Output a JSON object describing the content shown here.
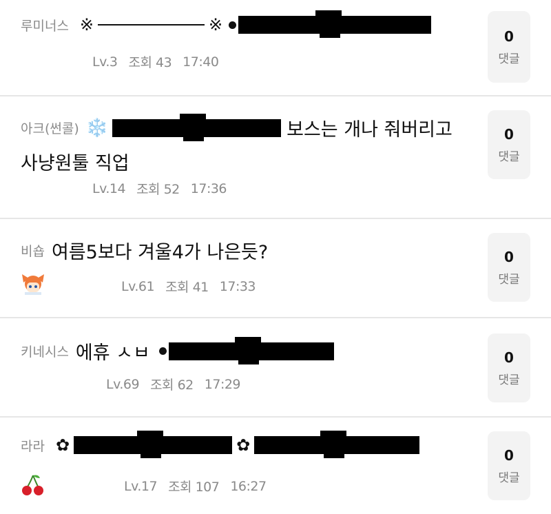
{
  "posts": [
    {
      "category": "루미너스",
      "title_prefix_1": "※",
      "title_prefix_2": "※",
      "title_text": "",
      "title_line2": "",
      "level": "Lv.3",
      "views": "조회 43",
      "time": "17:40",
      "comments": "0",
      "comments_label": "댓글"
    },
    {
      "category": "아크(썬콜)",
      "emoji": "❄️",
      "title_text": "보스는 개나 줘버리고",
      "title_line2": "사냥원툴 직업",
      "level": "Lv.14",
      "views": "조회 52",
      "time": "17:36",
      "comments": "0",
      "comments_label": "댓글"
    },
    {
      "category": "비숍",
      "title_text": "여름5보다 겨울4가 나은듯?",
      "title_line2": "",
      "level": "Lv.61",
      "views": "조회 41",
      "time": "17:33",
      "comments": "0",
      "comments_label": "댓글"
    },
    {
      "category": "키네시스",
      "title_text": "에휴 ㅅㅂ",
      "title_line2": "",
      "level": "Lv.69",
      "views": "조회 62",
      "time": "17:29",
      "comments": "0",
      "comments_label": "댓글"
    },
    {
      "category": "라라",
      "title_prefix_1": "✿",
      "title_prefix_2": "✿",
      "title_text": "",
      "title_line2": "",
      "level": "Lv.17",
      "views": "조회 107",
      "time": "16:27",
      "comments": "0",
      "comments_label": "댓글"
    }
  ]
}
